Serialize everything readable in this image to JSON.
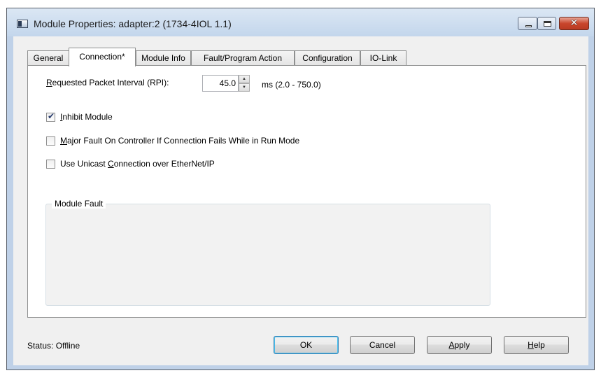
{
  "window": {
    "title": "Module Properties: adapter:2 (1734-4IOL 1.1)",
    "controls": {
      "minimize_icon": "minimize-icon",
      "maximize_icon": "maximize-icon",
      "close_icon": "close-icon"
    }
  },
  "tabs": [
    {
      "label": "General"
    },
    {
      "label": "Connection*",
      "active": true
    },
    {
      "label": "Module Info"
    },
    {
      "label": "Fault/Program Action"
    },
    {
      "label": "Configuration"
    },
    {
      "label": "IO-Link"
    }
  ],
  "connection": {
    "rpi_label_accel": "R",
    "rpi_label_rest": "equested Packet Interval (RPI):",
    "rpi_value": "45.0",
    "rpi_range": "ms (2.0 - 750.0)",
    "inhibit": {
      "accel": "I",
      "rest": "nhibit Module",
      "checked": true
    },
    "major_fault": {
      "accel": "M",
      "rest": "ajor Fault On Controller If Connection Fails While in Run Mode",
      "checked": false
    },
    "unicast": {
      "pre": "Use Unicast ",
      "accel": "C",
      "rest": "onnection over EtherNet/IP",
      "checked": false
    },
    "module_fault_label": "Module Fault"
  },
  "footer": {
    "status": "Status:  Offline",
    "ok": "OK",
    "cancel": "Cancel",
    "apply_accel": "A",
    "apply_rest": "pply",
    "help_accel": "H",
    "help_rest": "elp"
  },
  "colors": {
    "title_bar": "#c3d6ec",
    "close_button": "#c9462c",
    "dialog_bg": "#f0f0f0"
  }
}
